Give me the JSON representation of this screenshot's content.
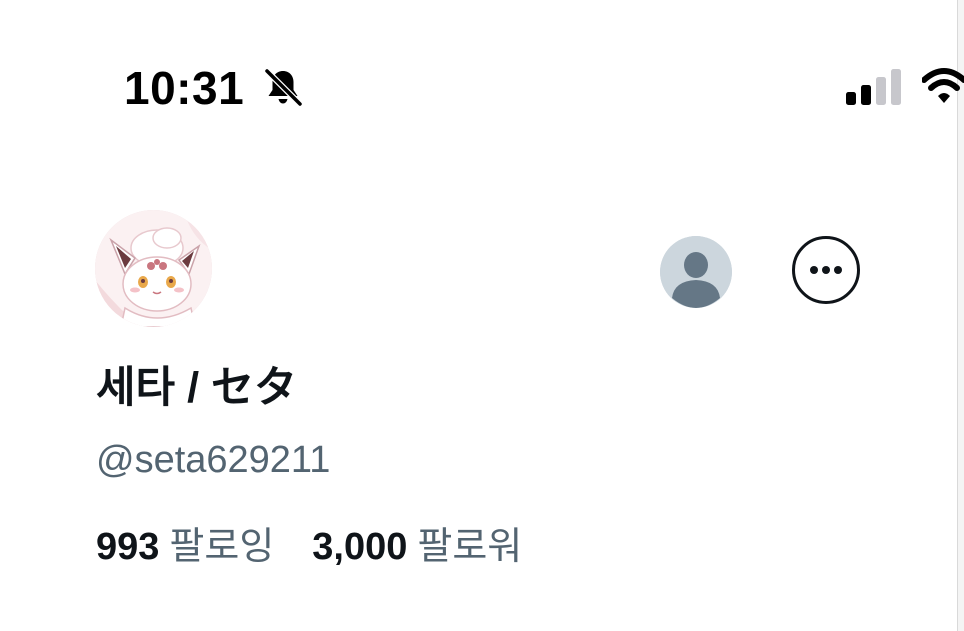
{
  "status_bar": {
    "time": "10:31",
    "icons": [
      "bell-slash-icon",
      "cellular-signal-icon",
      "wifi-icon"
    ]
  },
  "profile": {
    "display_name": "세타 / セタ",
    "handle": "@seta629211",
    "following_count": "993",
    "following_label": "팔로잉",
    "followers_count": "3,000",
    "followers_label": "팔로워"
  },
  "actions": {
    "icons": [
      "default-avatar-icon",
      "more-options-icon"
    ]
  },
  "colors": {
    "text_primary": "#0f1419",
    "text_secondary": "#536471",
    "default_avatar_bg": "#ccd6dd",
    "default_avatar_fg": "#657786"
  }
}
